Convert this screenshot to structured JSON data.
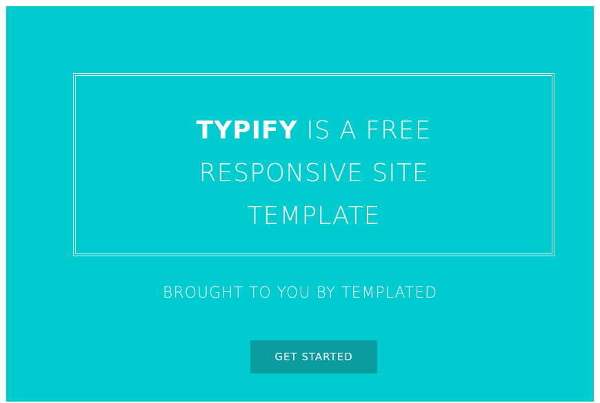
{
  "hero": {
    "headline_brand": "TYPIFY",
    "headline_line1_rest": " IS A FREE",
    "headline_line2": "RESPONSIVE SITE",
    "headline_line3": "TEMPLATE",
    "tagline": "BROUGHT TO YOU BY TEMPLATED",
    "cta_label": "GET STARTED"
  },
  "colors": {
    "background": "#00cccf",
    "button": "#0a9c9e",
    "text": "#ffffff"
  }
}
